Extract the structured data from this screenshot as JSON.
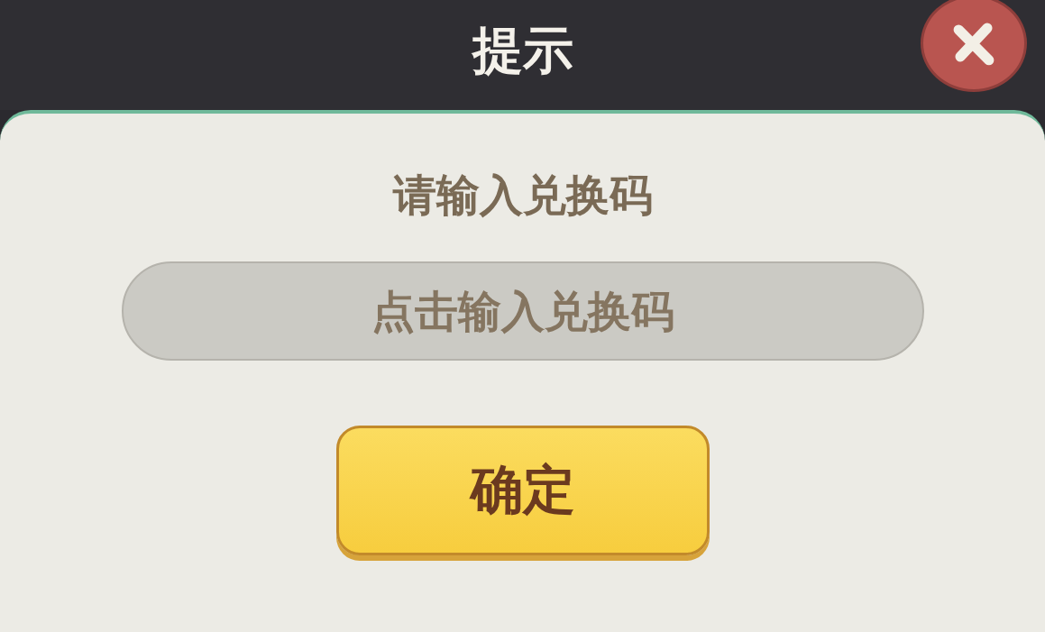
{
  "dialog": {
    "title": "提示",
    "prompt": "请输入兑换码",
    "code_field": {
      "placeholder": "点击输入兑换码"
    },
    "confirm_button": "确定"
  }
}
